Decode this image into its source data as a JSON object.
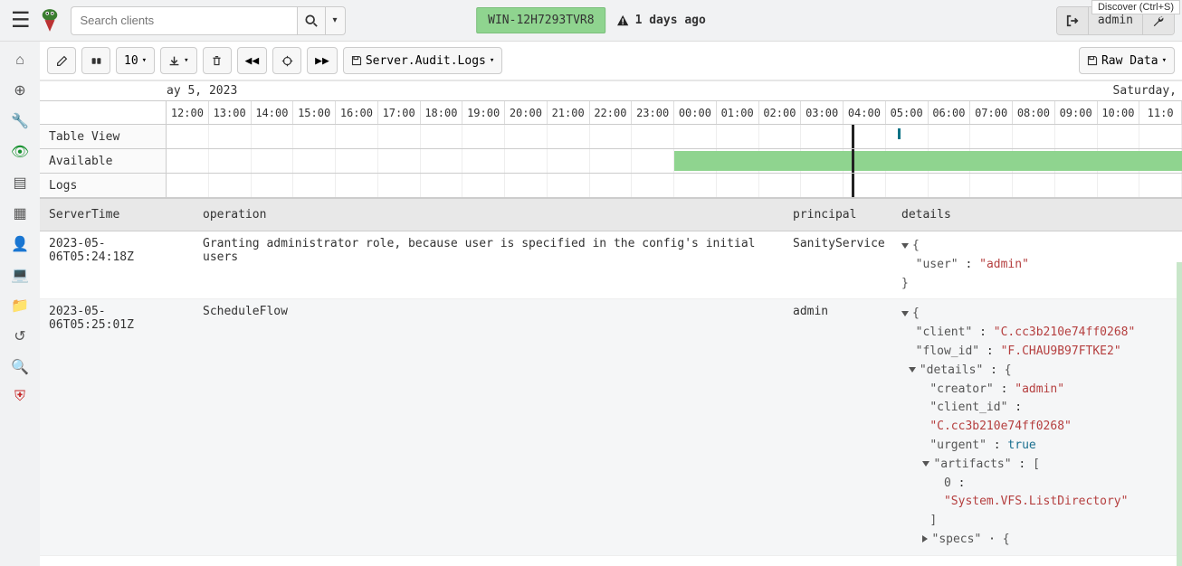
{
  "topbar": {
    "search_placeholder": "Search clients",
    "host_badge": "WIN-12H7293TVR8",
    "warn_text": "1 days ago",
    "user": "admin",
    "tooltip": "Discover (Ctrl+S)"
  },
  "toolbar": {
    "page_size": "10",
    "artifact_label": "Server.Audit.Logs",
    "raw_data": "Raw Data"
  },
  "timeline": {
    "left_day": "ay 5, 2023",
    "right_day": "Saturday,",
    "hours": [
      "12:00",
      "13:00",
      "14:00",
      "15:00",
      "16:00",
      "17:00",
      "18:00",
      "19:00",
      "20:00",
      "21:00",
      "22:00",
      "23:00",
      "00:00",
      "01:00",
      "02:00",
      "03:00",
      "04:00",
      "05:00",
      "06:00",
      "07:00",
      "08:00",
      "09:00",
      "10:00",
      "11:0"
    ],
    "rows": {
      "table_view": "Table View",
      "available": "Available",
      "logs": "Logs"
    }
  },
  "table": {
    "headers": {
      "time": "ServerTime",
      "op": "operation",
      "prin": "principal",
      "det": "details"
    },
    "rows": [
      {
        "time": "2023-05-06T05:24:18Z",
        "op": "Granting administrator role, because user is specified in the config's initial users",
        "prin": "SanityService",
        "details_type": "user_admin"
      },
      {
        "time": "2023-05-06T05:25:01Z",
        "op": "ScheduleFlow",
        "prin": "admin",
        "details_type": "flow"
      }
    ]
  },
  "details": {
    "user_admin": {
      "user": "admin"
    },
    "flow": {
      "client": "C.cc3b210e74ff0268",
      "flow_id": "F.CHAU9B97FTKE2",
      "details": {
        "creator": "admin",
        "client_id": "C.cc3b210e74ff0268",
        "urgent": true,
        "artifacts": [
          "System.VFS.ListDirectory"
        ]
      },
      "more_key": "specs"
    }
  }
}
